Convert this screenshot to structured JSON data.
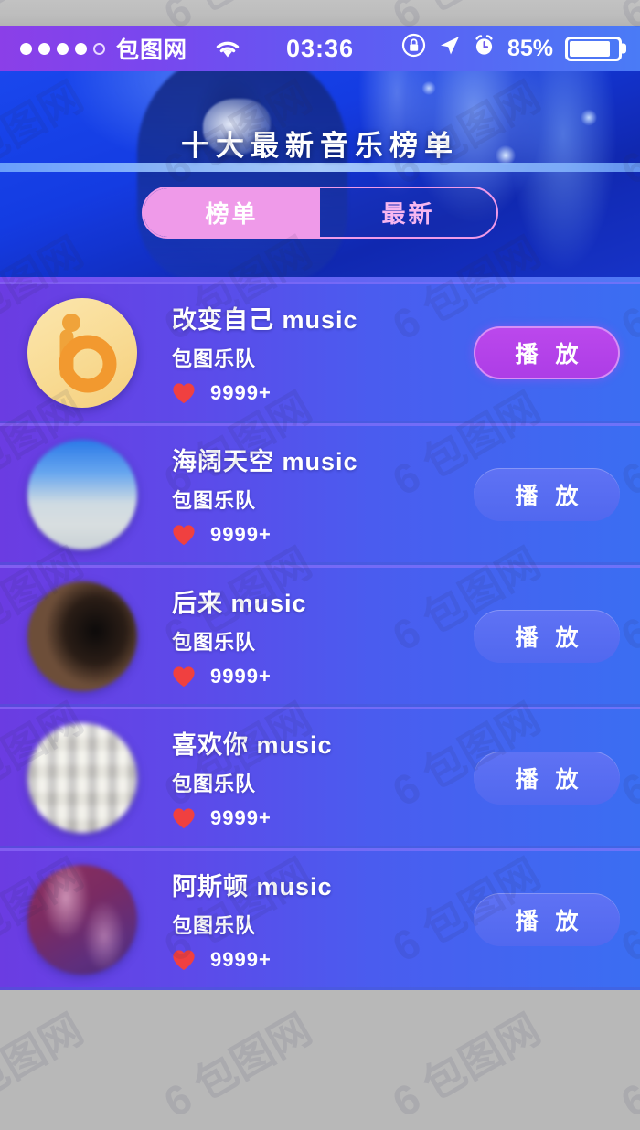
{
  "status_bar": {
    "carrier": "包图网",
    "signal_dots_filled": 4,
    "signal_dots_total": 5,
    "wifi_icon": "wifi-icon",
    "time": "03:36",
    "rotation_lock_icon": "rotation-lock-icon",
    "location_icon": "location-arrow-icon",
    "alarm_icon": "alarm-clock-icon",
    "battery_percent": "85%",
    "battery_level": 85
  },
  "hero": {
    "title": "十大最新音乐榜单",
    "tabs": [
      {
        "label": "榜单",
        "active": true
      },
      {
        "label": "最新",
        "active": false
      }
    ]
  },
  "colors": {
    "accent_pink": "#ef9ae9",
    "accent_purple": "#b341e8",
    "button_blue": "#5b6ef0",
    "heart_red": "#f04040",
    "card_gradient_start": "#6b3ce2",
    "card_gradient_end": "#3b6ef2",
    "status_bar_start": "#8b3fe8",
    "status_bar_end": "#4a7bf6"
  },
  "songs": [
    {
      "title": "改变自己 music",
      "artist": "包图乐队",
      "likes": "9999+",
      "play_label": "播 放",
      "playing": true,
      "avatar_style": "av-logo",
      "avatar_name": "avatar-logo-b"
    },
    {
      "title": "海阔天空 music",
      "artist": "包图乐队",
      "likes": "9999+",
      "play_label": "播 放",
      "playing": false,
      "avatar_style": "av-sky",
      "avatar_name": "avatar-sky"
    },
    {
      "title": "后来 music",
      "artist": "包图乐队",
      "likes": "9999+",
      "play_label": "播 放",
      "playing": false,
      "avatar_style": "av-dark",
      "avatar_name": "avatar-dark-portrait"
    },
    {
      "title": "喜欢你 music",
      "artist": "包图乐队",
      "likes": "9999+",
      "play_label": "播 放",
      "playing": false,
      "avatar_style": "av-light",
      "avatar_name": "avatar-light-crowd"
    },
    {
      "title": "阿斯顿 music",
      "artist": "包图乐队",
      "likes": "9999+",
      "play_label": "播 放",
      "playing": false,
      "avatar_style": "av-purple",
      "avatar_name": "avatar-purple"
    }
  ],
  "watermark": {
    "text": "包图网"
  }
}
